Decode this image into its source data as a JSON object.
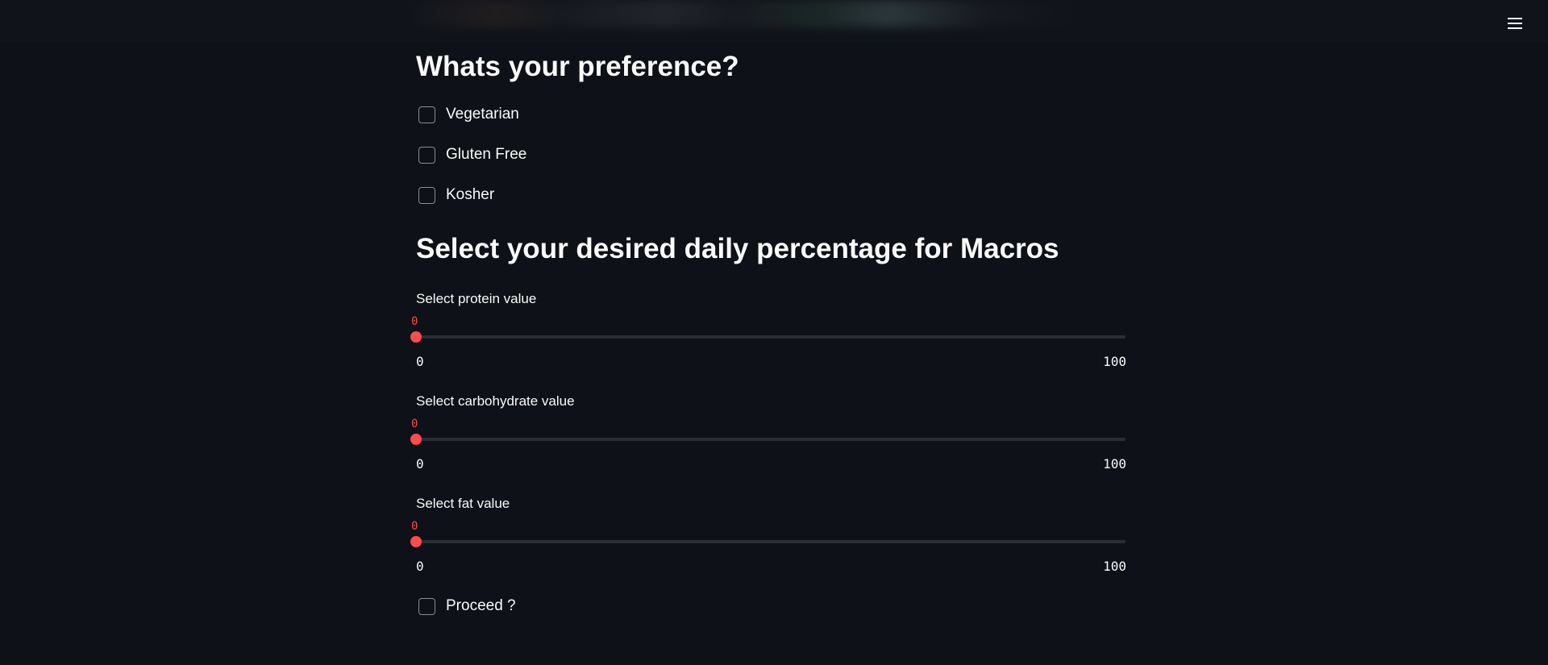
{
  "header": {
    "menu_icon": "hamburger-menu-icon"
  },
  "preferences": {
    "title": "Whats your preference?",
    "options": [
      {
        "label": "Vegetarian",
        "checked": false
      },
      {
        "label": "Gluten Free",
        "checked": false
      },
      {
        "label": "Kosher",
        "checked": false
      }
    ]
  },
  "macros": {
    "title": "Select your desired daily percentage for Macros",
    "sliders": [
      {
        "label": "Select protein value",
        "value": "0",
        "min": "0",
        "max": "100"
      },
      {
        "label": "Select carbohydrate value",
        "value": "0",
        "min": "0",
        "max": "100"
      },
      {
        "label": "Select fat value",
        "value": "0",
        "min": "0",
        "max": "100"
      }
    ]
  },
  "proceed": {
    "label": "Proceed ?",
    "checked": false
  },
  "colors": {
    "background": "#0e1117",
    "accent": "#ff4b4b",
    "text": "#fafafa",
    "track": "#2a2d35"
  }
}
